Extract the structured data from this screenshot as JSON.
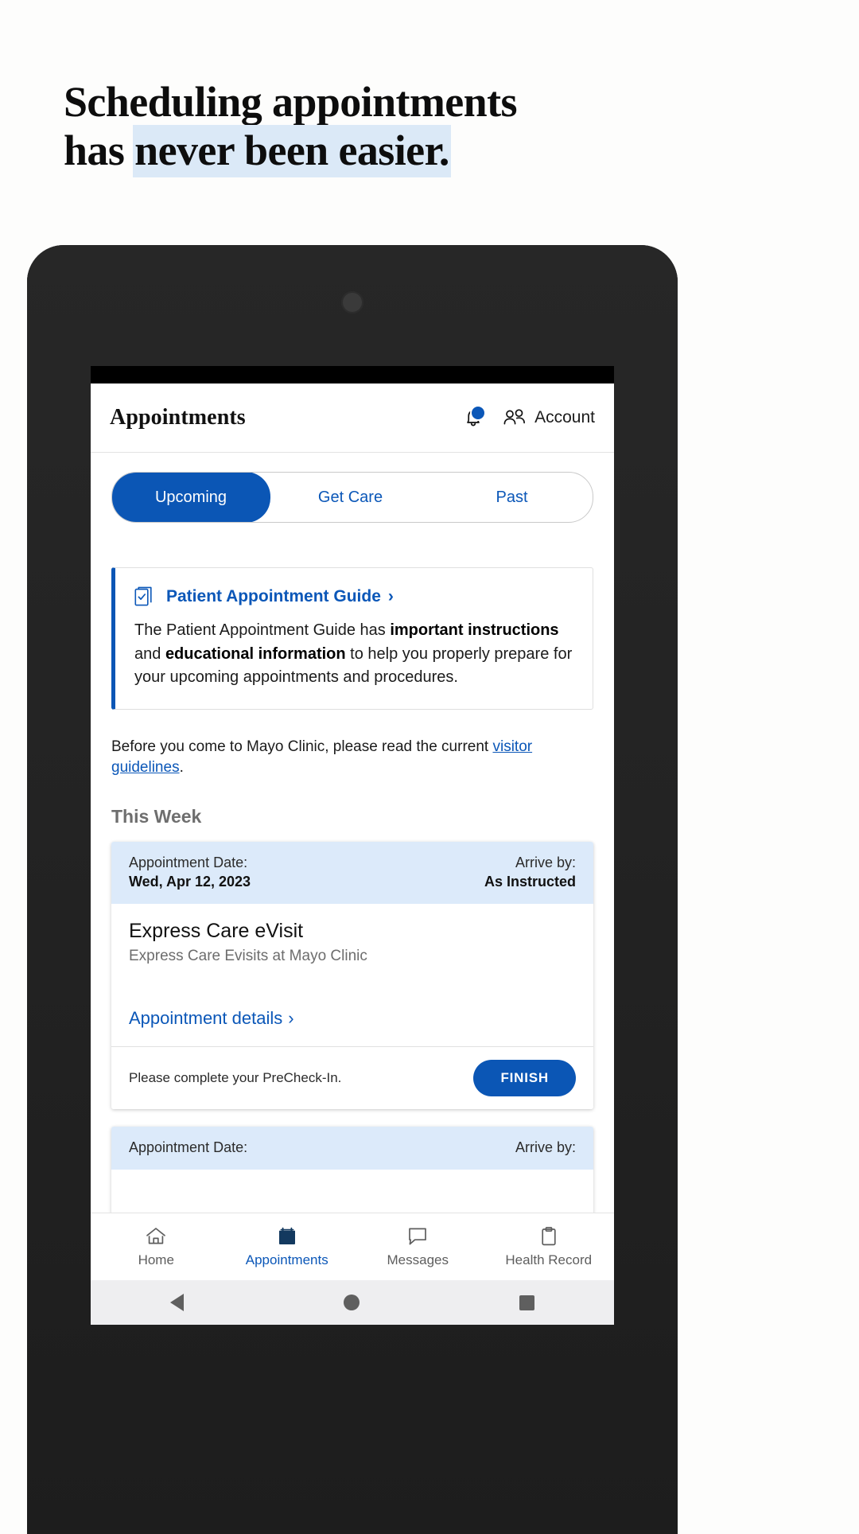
{
  "promo": {
    "headline_line1": "Scheduling appointments",
    "headline_line2_plain": "has ",
    "headline_line2_highlight": "never been easier.",
    "highlight_color": "#dbe9f7"
  },
  "app": {
    "header": {
      "title": "Appointments",
      "notifications_icon": "bell-icon",
      "has_notification_badge": true,
      "account_label": "Account",
      "account_icon": "people-icon"
    },
    "tabs": [
      {
        "label": "Upcoming",
        "active": true
      },
      {
        "label": "Get Care",
        "active": false
      },
      {
        "label": "Past",
        "active": false
      }
    ],
    "guide_card": {
      "icon": "document-check-icon",
      "title": "Patient Appointment Guide",
      "chevron": "›",
      "body_part1": "The Patient Appointment Guide has ",
      "body_bold1": "important instructions",
      "body_part2": " and ",
      "body_bold2": "educational information",
      "body_part3": " to help you properly prepare for your upcoming appointments and procedures."
    },
    "visitor_notice": {
      "text_before": "Before you come to Mayo Clinic, please read the current ",
      "link_text": "visitor guidelines",
      "text_after": "."
    },
    "section_title": "This Week",
    "appointments": [
      {
        "date_label": "Appointment Date:",
        "date_value": "Wed, Apr 12, 2023",
        "arrive_label": "Arrive by:",
        "arrive_value": "As Instructed",
        "name": "Express Care eVisit",
        "subtitle": "Express Care Evisits at Mayo Clinic",
        "details_link": "Appointment details",
        "details_chevron": "›",
        "footer_text": "Please complete your PreCheck-In.",
        "footer_button": "FINISH"
      },
      {
        "date_label": "Appointment Date:",
        "arrive_label": "Arrive by:"
      }
    ],
    "bottom_nav": [
      {
        "label": "Home",
        "icon": "home-icon",
        "active": false
      },
      {
        "label": "Appointments",
        "icon": "calendar-icon",
        "active": true
      },
      {
        "label": "Messages",
        "icon": "message-bubble-icon",
        "active": false
      },
      {
        "label": "Health Record",
        "icon": "clipboard-icon",
        "active": false
      }
    ],
    "android_nav": [
      {
        "name": "back-button",
        "glyph": "triangle"
      },
      {
        "name": "home-button",
        "glyph": "circle"
      },
      {
        "name": "recents-button",
        "glyph": "square"
      }
    ],
    "colors": {
      "primary_blue": "#0b56b5",
      "link_blue": "#0b57b8",
      "card_header_blue": "#dceafa",
      "nav_active_navy": "#13395f"
    }
  }
}
